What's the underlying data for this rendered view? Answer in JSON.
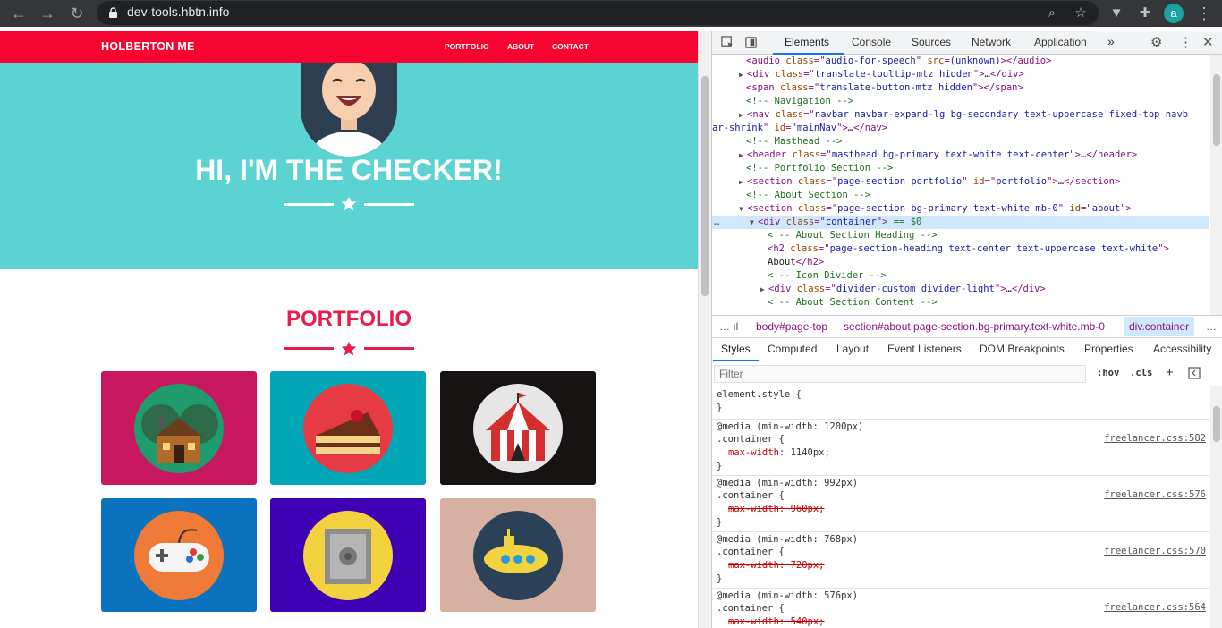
{
  "browser": {
    "url": "dev-tools.hbtn.info"
  },
  "site": {
    "brand": "HOLBERTON ME",
    "nav": [
      "PORTFOLIO",
      "ABOUT",
      "CONTACT"
    ],
    "hero_title": "HI, I'M THE CHECKER!",
    "portfolio_title": "PORTFOLIO",
    "tile_colors": [
      "#c7185f",
      "#00a6b6",
      "#171312",
      "#0b73bd",
      "#3f00b4",
      "#d6b1a1"
    ],
    "tile_icons": [
      "cabin-icon",
      "cake-icon",
      "circus-tent-icon",
      "game-controller-icon",
      "safe-icon",
      "submarine-icon"
    ]
  },
  "devtools": {
    "tabs": [
      "Elements",
      "Console",
      "Sources",
      "Network",
      "Application"
    ],
    "dom_lines": [
      {
        "indent": 38,
        "parts": [
          [
            "tg",
            "<audio "
          ],
          [
            "at",
            "class"
          ],
          [
            "tg",
            "=\""
          ],
          [
            "av",
            "audio-for-speech"
          ],
          [
            "tg",
            "\" "
          ],
          [
            "at",
            "src"
          ],
          [
            "tg",
            "="
          ],
          [
            "av",
            "(unknown)"
          ],
          [
            "tg",
            "></audio>"
          ]
        ]
      },
      {
        "indent": 30,
        "arrow": "▶",
        "parts": [
          [
            "tg",
            "<div "
          ],
          [
            "at",
            "class"
          ],
          [
            "tg",
            "=\""
          ],
          [
            "av",
            "translate-tooltip-mtz hidden"
          ],
          [
            "tg",
            "\">"
          ],
          [
            "tx",
            "…"
          ],
          [
            "tg",
            "</div>"
          ]
        ]
      },
      {
        "indent": 38,
        "parts": [
          [
            "tg",
            "<span "
          ],
          [
            "at",
            "class"
          ],
          [
            "tg",
            "=\""
          ],
          [
            "av",
            "translate-button-mtz hidden"
          ],
          [
            "tg",
            "\"></span>"
          ]
        ]
      },
      {
        "indent": 38,
        "parts": [
          [
            "cm",
            "<!-- Navigation -->"
          ]
        ]
      },
      {
        "indent": 30,
        "arrow": "▶",
        "parts": [
          [
            "tg",
            "<nav "
          ],
          [
            "at",
            "class"
          ],
          [
            "tg",
            "=\""
          ],
          [
            "av",
            "navbar navbar-expand-lg bg-secondary text-uppercase fixed-top navb"
          ]
        ]
      },
      {
        "indent": 0,
        "parts": [
          [
            "av",
            "ar-shrink"
          ],
          [
            "tg",
            "\" "
          ],
          [
            "at",
            "id"
          ],
          [
            "tg",
            "=\""
          ],
          [
            "av",
            "mainNav"
          ],
          [
            "tg",
            "\">"
          ],
          [
            "tx",
            "…"
          ],
          [
            "tg",
            "</nav>"
          ]
        ]
      },
      {
        "indent": 38,
        "parts": [
          [
            "cm",
            "<!-- Masthead -->"
          ]
        ]
      },
      {
        "indent": 30,
        "arrow": "▶",
        "parts": [
          [
            "tg",
            "<header "
          ],
          [
            "at",
            "class"
          ],
          [
            "tg",
            "=\""
          ],
          [
            "av",
            "masthead bg-primary text-white text-center"
          ],
          [
            "tg",
            "\">"
          ],
          [
            "tx",
            "…"
          ],
          [
            "tg",
            "</header>"
          ]
        ]
      },
      {
        "indent": 38,
        "parts": [
          [
            "cm",
            "<!-- Portfolio Section -->"
          ]
        ]
      },
      {
        "indent": 30,
        "arrow": "▶",
        "parts": [
          [
            "tg",
            "<section "
          ],
          [
            "at",
            "class"
          ],
          [
            "tg",
            "=\""
          ],
          [
            "av",
            "page-section portfolio"
          ],
          [
            "tg",
            "\" "
          ],
          [
            "at",
            "id"
          ],
          [
            "tg",
            "=\""
          ],
          [
            "av",
            "portfolio"
          ],
          [
            "tg",
            "\">"
          ],
          [
            "tx",
            "…"
          ],
          [
            "tg",
            "</section>"
          ]
        ]
      },
      {
        "indent": 38,
        "parts": [
          [
            "cm",
            "<!-- About Section -->"
          ]
        ]
      },
      {
        "indent": 30,
        "arrow": "▼",
        "parts": [
          [
            "tg",
            "<section "
          ],
          [
            "at",
            "class"
          ],
          [
            "tg",
            "=\""
          ],
          [
            "av",
            "page-section bg-primary text-white mb-0"
          ],
          [
            "tg",
            "\" "
          ],
          [
            "at",
            "id"
          ],
          [
            "tg",
            "=\""
          ],
          [
            "av",
            "about"
          ],
          [
            "tg",
            "\">"
          ]
        ]
      },
      {
        "indent": 42,
        "arrow": "▼",
        "selected": true,
        "parts": [
          [
            "tg",
            "<div "
          ],
          [
            "at",
            "class"
          ],
          [
            "tg",
            "=\""
          ],
          [
            "av",
            "container"
          ],
          [
            "tg",
            "\">"
          ],
          [
            "cm",
            " == $0"
          ]
        ]
      },
      {
        "indent": 62,
        "parts": [
          [
            "cm",
            "<!-- About Section Heading -->"
          ]
        ]
      },
      {
        "indent": 62,
        "parts": [
          [
            "tg",
            "<h2 "
          ],
          [
            "at",
            "class"
          ],
          [
            "tg",
            "=\""
          ],
          [
            "av",
            "page-section-heading text-center text-uppercase text-white"
          ],
          [
            "tg",
            "\">"
          ]
        ]
      },
      {
        "indent": 62,
        "parts": [
          [
            "tx",
            "About"
          ],
          [
            "tg",
            "</h2>"
          ]
        ]
      },
      {
        "indent": 62,
        "parts": [
          [
            "cm",
            "<!-- Icon Divider -->"
          ]
        ]
      },
      {
        "indent": 54,
        "arrow": "▶",
        "parts": [
          [
            "tg",
            "<div "
          ],
          [
            "at",
            "class"
          ],
          [
            "tg",
            "=\""
          ],
          [
            "av",
            "divider-custom divider-light"
          ],
          [
            "tg",
            "\">"
          ],
          [
            "tx",
            "…"
          ],
          [
            "tg",
            "</div>"
          ]
        ]
      },
      {
        "indent": 62,
        "parts": [
          [
            "cm",
            "<!-- About Section Content -->"
          ]
        ]
      }
    ],
    "breadcrumbs": [
      "body#page-top",
      "section#about.page-section.bg-primary.text-white.mb-0",
      "div.container"
    ],
    "subtabs": [
      "Styles",
      "Computed",
      "Layout",
      "Event Listeners",
      "DOM Breakpoints",
      "Properties",
      "Accessibility"
    ],
    "filter_placeholder": "Filter",
    "hov": ":hov",
    "cls": ".cls",
    "element_style": "element.style {",
    "close_brace": "}",
    "media_rules": [
      {
        "media": "@media (min-width: 1200px)",
        "selector": ".container {",
        "prop": "max-width",
        "value": "1140px;",
        "struck": false,
        "source": "freelancer.css:582"
      },
      {
        "media": "@media (min-width: 992px)",
        "selector": ".container {",
        "prop": "max-width",
        "value": "960px;",
        "struck": true,
        "source": "freelancer.css:576"
      },
      {
        "media": "@media (min-width: 768px)",
        "selector": ".container {",
        "prop": "max-width",
        "value": "720px;",
        "struck": true,
        "source": "freelancer.css:570"
      },
      {
        "media": "@media (min-width: 576px)",
        "selector": ".container {",
        "prop": "max-width",
        "value": "540px;",
        "struck": true,
        "source": "freelancer.css:564"
      }
    ]
  }
}
